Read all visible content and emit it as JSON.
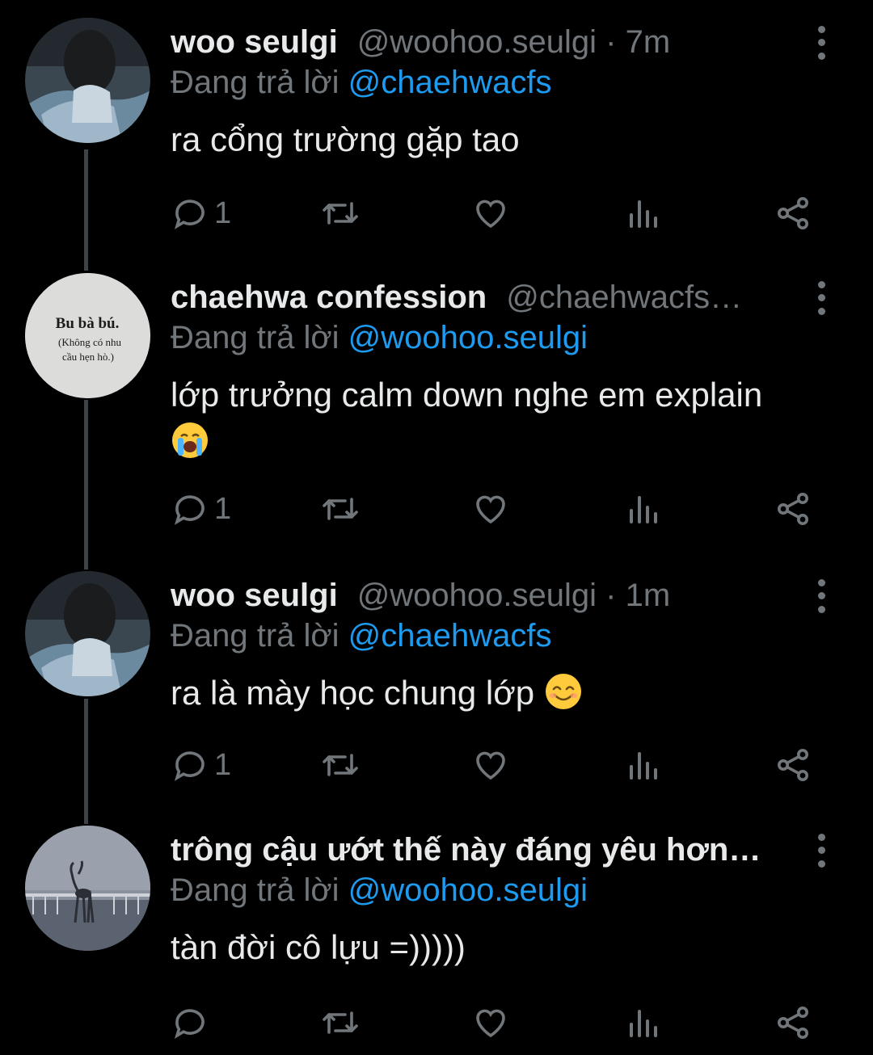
{
  "colors": {
    "background": "#000000",
    "primary_text": "#e7e9ea",
    "secondary_text": "#71767b",
    "mention": "#1d9bf0",
    "thread_line": "#3d4247"
  },
  "tweets": [
    {
      "name": "woo seulgi",
      "handle": "@woohoo.seulgi",
      "time": "7m",
      "replying_prefix": "Đang trả lời",
      "replying_to": "@chaehwacfs",
      "text": "ra cổng trường gặp tao",
      "emoji": "",
      "reply_count": "1",
      "avatar_icon": "profile-photo-girl"
    },
    {
      "name": "chaehwa confession",
      "handle": "@chaehwacfs…",
      "time": "",
      "replying_prefix": "Đang trả lời",
      "replying_to": "@woohoo.seulgi",
      "text": "lớp trưởng calm down nghe em explain",
      "emoji": "loudly-crying-face",
      "reply_count": "1",
      "avatar_icon": "text-avatar",
      "avatar_text": {
        "line1": "Bu bà bú.",
        "line2": "(Không có nhu",
        "line3": "cầu hẹn hò.)"
      }
    },
    {
      "name": "woo seulgi",
      "handle": "@woohoo.seulgi",
      "time": "1m",
      "replying_prefix": "Đang trả lời",
      "replying_to": "@chaehwacfs",
      "text": "ra là mày học chung lớp",
      "emoji": "smiling-face-with-smiling-eyes",
      "reply_count": "1",
      "avatar_icon": "profile-photo-girl"
    },
    {
      "name": "trông cậu ướt thế này đáng yêu hơn…",
      "handle": "",
      "time": "",
      "replying_prefix": "Đang trả lời",
      "replying_to": "@woohoo.seulgi",
      "text": "tàn đời cô lựu =)))))",
      "emoji": "",
      "reply_count": "",
      "avatar_icon": "deer-statue-photo"
    }
  ]
}
